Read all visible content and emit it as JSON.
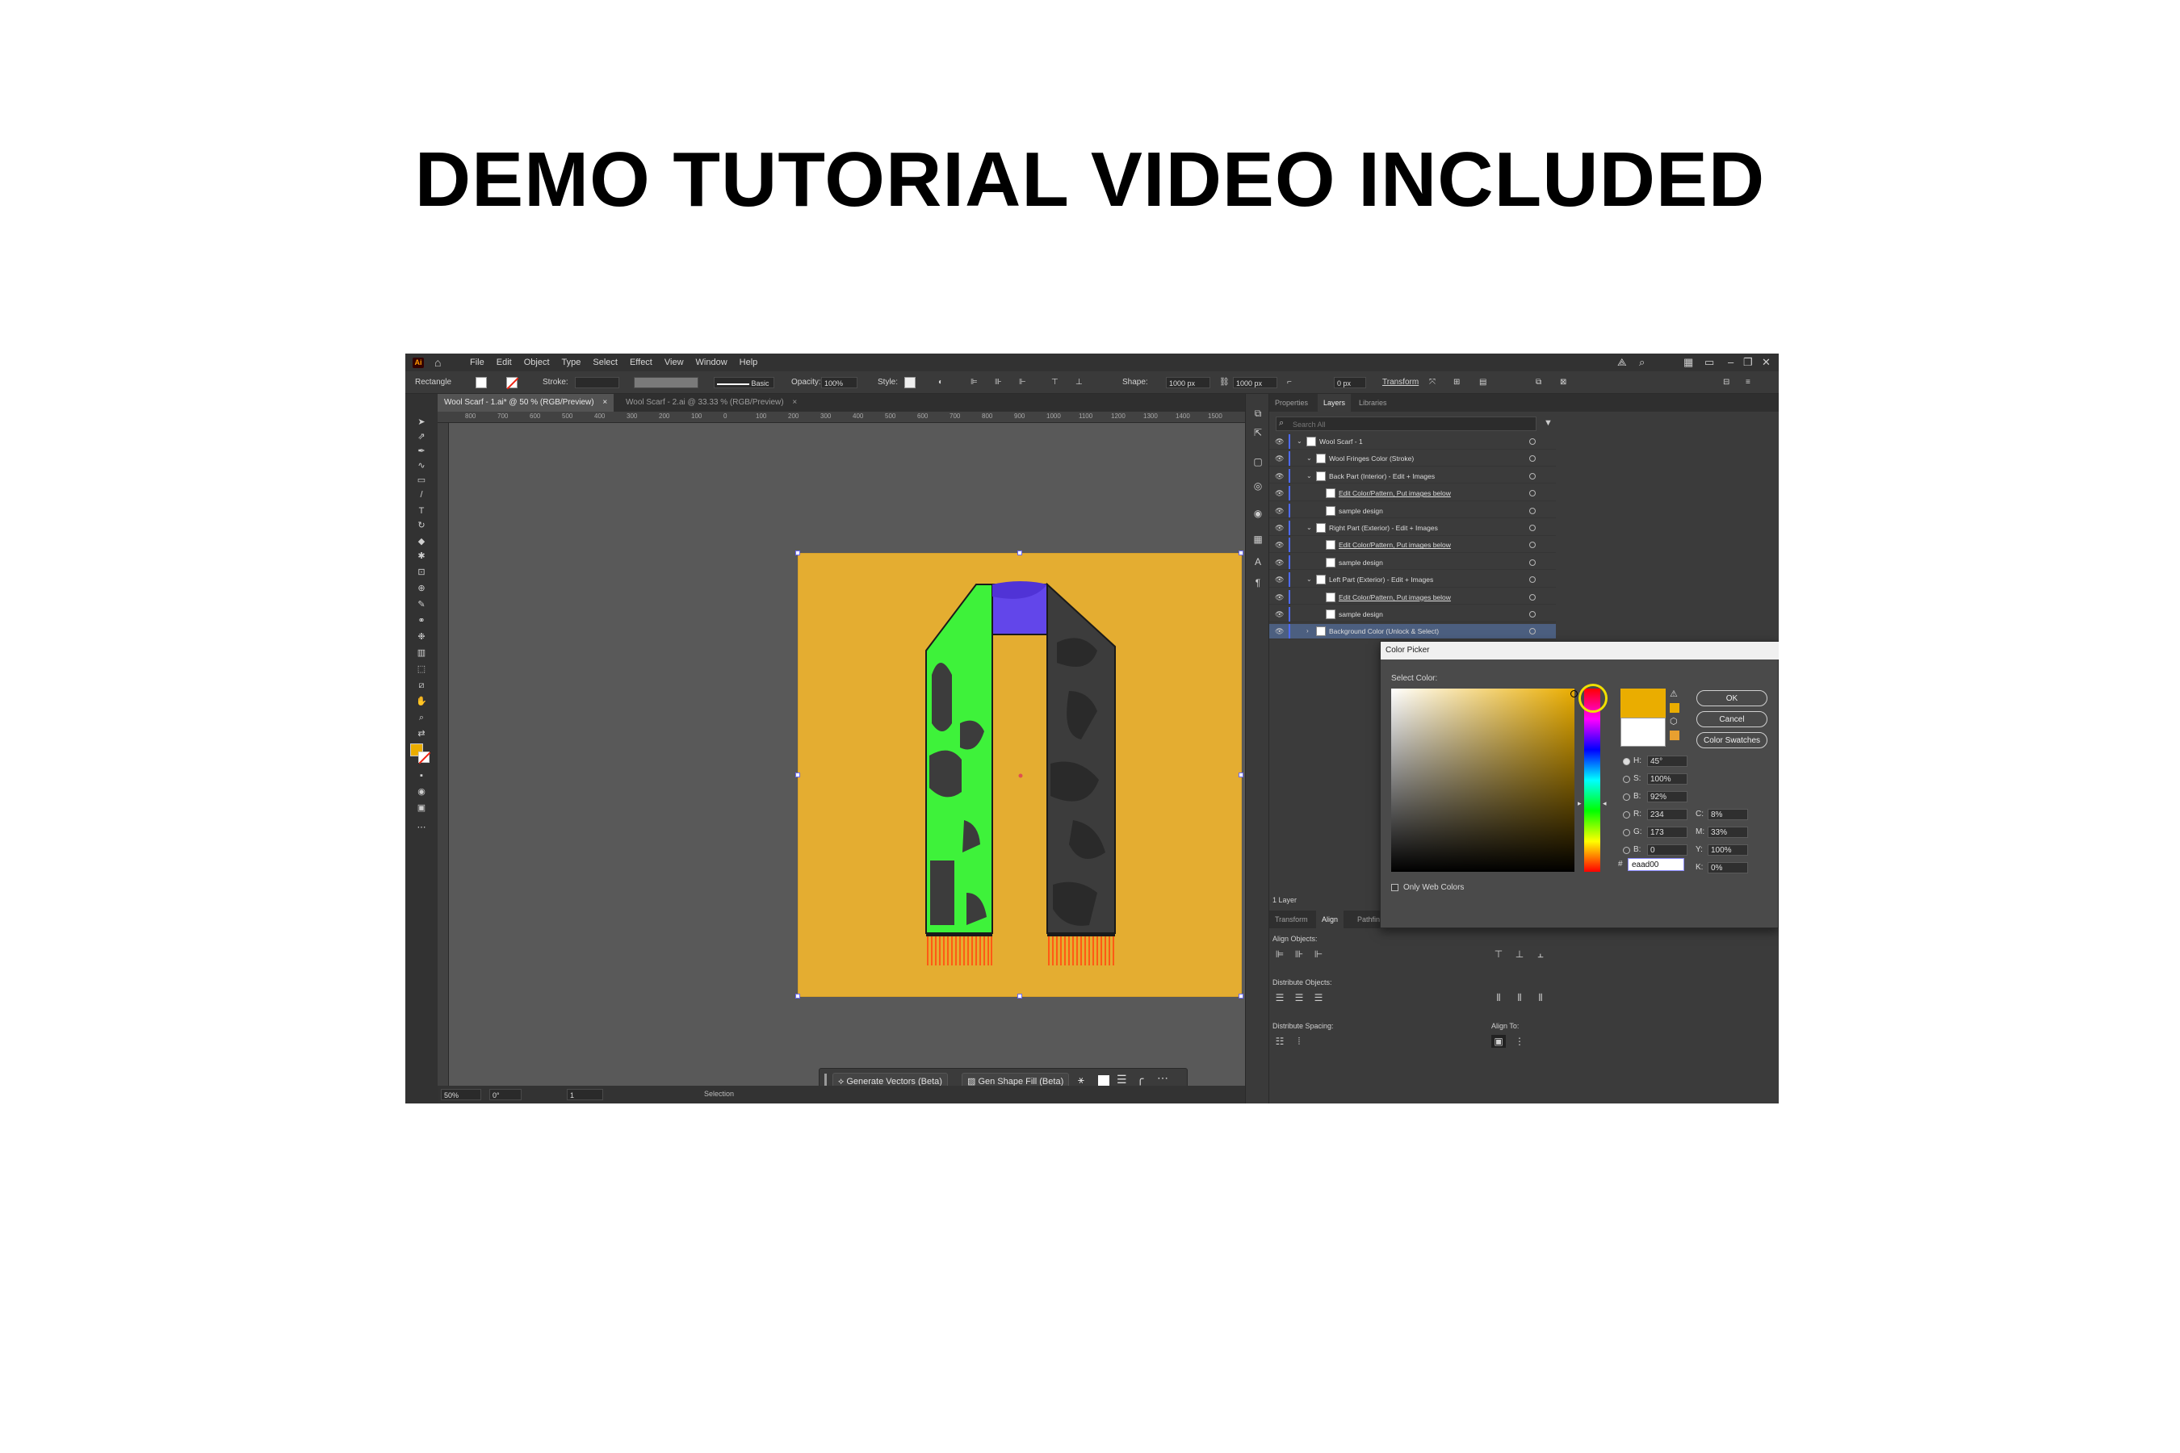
{
  "headline": "DEMO TUTORIAL VIDEO INCLUDED",
  "app": {
    "logo": "Ai",
    "menu": [
      "File",
      "Edit",
      "Object",
      "Type",
      "Select",
      "Effect",
      "View",
      "Window",
      "Help"
    ]
  },
  "control_bar": {
    "tool_name": "Rectangle",
    "stroke_label": "Stroke:",
    "brush_label": "Basic",
    "opacity_label": "Opacity:",
    "opacity_value": "100%",
    "style_label": "Style:",
    "shape_label": "Shape:",
    "width_value": "1000 px",
    "height_value": "1000 px",
    "corner_value": "0 px",
    "transform_label": "Transform"
  },
  "tabs": [
    {
      "label": "Wool Scarf - 1.ai* @ 50 % (RGB/Preview)",
      "close": "×"
    },
    {
      "label": "Wool Scarf - 2.ai @ 33.33 % (RGB/Preview)",
      "close": "×"
    }
  ],
  "ruler": {
    "h_ticks": [
      "800",
      "700",
      "600",
      "500",
      "400",
      "300",
      "200",
      "100",
      "0",
      "100",
      "200",
      "300",
      "400",
      "500",
      "600",
      "700",
      "800",
      "900",
      "1000",
      "1100",
      "1200",
      "1300",
      "1400",
      "1500"
    ]
  },
  "taskbar": {
    "generate_vectors": "Generate Vectors (Beta)",
    "gen_shape_fill": "Gen Shape Fill (Beta)"
  },
  "status": {
    "zoom": "50%",
    "rotation": "0°",
    "artboard": "1",
    "mode": "Selection"
  },
  "layers_panel": {
    "tabs": [
      "Properties",
      "Layers",
      "Libraries"
    ],
    "active_tab": "Layers",
    "search_placeholder": "Search All",
    "rows": [
      {
        "name": "Wool Scarf - 1",
        "indent": 0
      },
      {
        "name": "Wool Fringes Color (Stroke)",
        "indent": 1
      },
      {
        "name": "Back Part (Interior) - Edit + Images",
        "indent": 1
      },
      {
        "name": "Edit Color/Pattern, Put images below",
        "indent": 2
      },
      {
        "name": "sample design",
        "indent": 2
      },
      {
        "name": "Right Part (Exterior) - Edit + Images",
        "indent": 1
      },
      {
        "name": "Edit Color/Pattern, Put images below",
        "indent": 2
      },
      {
        "name": "sample design",
        "indent": 2
      },
      {
        "name": "Left Part (Exterior) - Edit + Images",
        "indent": 1
      },
      {
        "name": "Edit Color/Pattern, Put images below",
        "indent": 2
      },
      {
        "name": "sample design",
        "indent": 2
      },
      {
        "name": "Background Color (Unlock & Select)",
        "indent": 1
      }
    ],
    "layer_count": "1 Layer"
  },
  "align_panel": {
    "tabs": [
      "Transform",
      "Align",
      "Pathfinder"
    ],
    "active_tab": "Align",
    "align_objects": "Align Objects:",
    "distribute_objects": "Distribute Objects:",
    "distribute_spacing": "Distribute Spacing:",
    "align_to": "Align To:"
  },
  "color_picker": {
    "title": "Color Picker",
    "select_label": "Select Color:",
    "ok": "OK",
    "cancel": "Cancel",
    "swatches": "Color Swatches",
    "hsb": [
      {
        "label": "H:",
        "value": "45°"
      },
      {
        "label": "S:",
        "value": "100%"
      },
      {
        "label": "B:",
        "value": "92%"
      }
    ],
    "rgb": [
      {
        "label": "R:",
        "value": "234"
      },
      {
        "label": "G:",
        "value": "173"
      },
      {
        "label": "B:",
        "value": "0"
      }
    ],
    "cmyk": [
      {
        "label": "C:",
        "value": "8%"
      },
      {
        "label": "M:",
        "value": "33%"
      },
      {
        "label": "Y:",
        "value": "100%"
      },
      {
        "label": "K:",
        "value": "0%"
      }
    ],
    "hash": "#",
    "hex": "eaad00",
    "only_web": "Only Web Colors",
    "new_color": "#eaad00",
    "current_color": "#ffffff"
  },
  "colors": {
    "artboard": "#e4ad31",
    "scarf_green": "#3ef23a",
    "scarf_purple": "#6246ea",
    "scarf_dark": "#3c3c3c",
    "fringe": "#ff5a14"
  }
}
